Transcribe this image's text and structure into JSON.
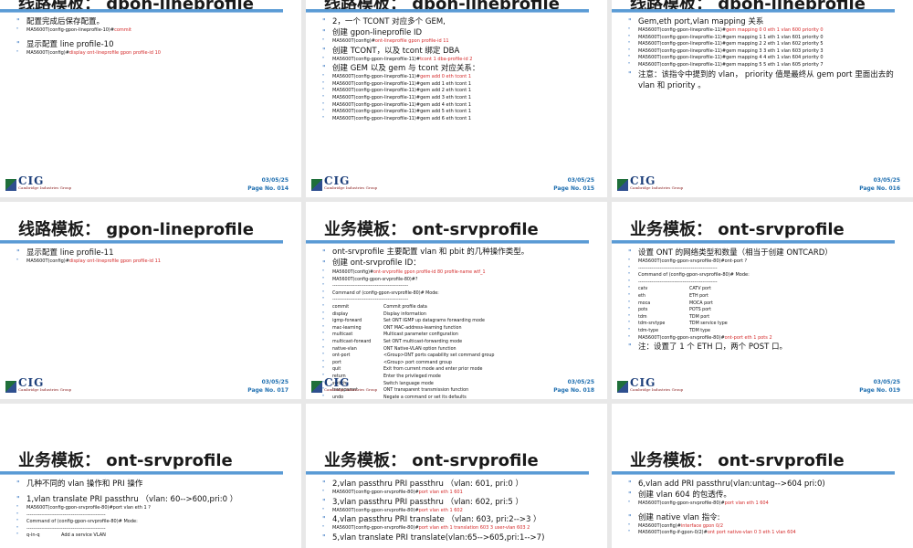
{
  "footer": {
    "date": "03/05/25",
    "logo": "CIG",
    "logo_sub": "Cambridge Industries Group",
    "page_prefix": "Page No. "
  },
  "slides": {
    "s14": {
      "title": "线路模板： gpon-lineprofile",
      "page": "014",
      "l1": "配置完成后保存配置。",
      "l2a": "MA5600T(config-gpon-lineprofile-10)#",
      "l2b": "commit",
      "l3": "显示配置 line profile-10",
      "l4a": "MA5600T(config)#",
      "l4b": "display ont-lineprofile gpon profile-id 10"
    },
    "s15": {
      "title": "线路模板： gpon-lineprofile",
      "page": "015",
      "l1": "2，一个 TCONT 对应多个 GEM,",
      "l2": "创建 gpon-lineprofile ID",
      "l3a": "MA5600T(config)#",
      "l3b": "ont-lineprofile gpon profile-id 11",
      "l4": "创建 TCONT，以及 tcont 绑定 DBA",
      "l5a": "MA5600T(config-gpon-lineprofile-11)#",
      "l5b": "tcont 1 dba-profile-id 2",
      "l6": "创建 GEM 以及 gem 与 tcont 对应关系：",
      "gems": [
        {
          "a": "MA5600T(config-gpon-lineprofile-11)#",
          "b": "gem add 0 eth tcont 1",
          "red": true
        },
        {
          "a": "MA5600T(config-gpon-lineprofile-11)#gem add 1 eth tcont 1",
          "b": "",
          "red": false
        },
        {
          "a": "MA5600T(config-gpon-lineprofile-11)#gem add 2 eth tcont 1",
          "b": "",
          "red": false
        },
        {
          "a": "MA5600T(config-gpon-lineprofile-11)#gem add 3 eth tcont 1",
          "b": "",
          "red": false
        },
        {
          "a": "MA5600T(config-gpon-lineprofile-11)#gem add 4 eth tcont 1",
          "b": "",
          "red": false
        },
        {
          "a": "MA5600T(config-gpon-lineprofile-11)#gem add 5 eth tcont 1",
          "b": "",
          "red": false
        },
        {
          "a": "MA5600T(config-gpon-lineprofile-11)#gem add 6 eth tcont 1",
          "b": "",
          "red": false
        }
      ]
    },
    "s16": {
      "title": "线路模板： gpon-lineprofile",
      "page": "016",
      "l1": "Gem,eth port,vlan mapping 关系",
      "maps": [
        {
          "a": "MA5600T(config-gpon-lineprofile-11)#",
          "b": "gem mapping 0 0 eth 1 vlan 600 priority 0",
          "red": true
        },
        {
          "a": "MA5600T(config-gpon-lineprofile-11)#gem mapping 1 1 eth 1 vlan 601 priority 0",
          "b": "",
          "red": false
        },
        {
          "a": "MA5600T(config-gpon-lineprofile-11)#gem mapping 2 2 eth 1 vlan 602 priority 5",
          "b": "",
          "red": false
        },
        {
          "a": "MA5600T(config-gpon-lineprofile-11)#gem mapping 3 3 eth 1 vlan 603 priority 3",
          "b": "",
          "red": false
        },
        {
          "a": "MA5600T(config-gpon-lineprofile-11)#gem mapping 4 4 eth 1 vlan 604 priority 0",
          "b": "",
          "red": false
        },
        {
          "a": "MA5600T(config-gpon-lineprofile-11)#gem mapping 5 5 eth 1 vlan 605 priority 7",
          "b": "",
          "red": false
        }
      ],
      "note": "注意：该指令中提到的 vlan， priority 值是最终从 gem port 里面出去的 vlan 和 priority 。"
    },
    "s17": {
      "title": "线路模板： gpon-lineprofile",
      "page": "017",
      "l1": "显示配置 line profile-11",
      "l2a": "MA5600T(config)#",
      "l2b": "display ont-lineprofile gpon profile-id 11"
    },
    "s18": {
      "title": "业务模板： ont-srvprofile",
      "page": "018",
      "l1": "ont-srvprofile 主要配置 vlan 和 pbit 的几种操作类型。",
      "l2": "创建 ont-srvprofile ID：",
      "l3a": "MA5600T(config)#",
      "l3b": "ont-srvprofile gpon profile-id 80 profile-name wtf_1",
      "l4": "MA5600T(config-gpon-srvprofile-80)#?",
      "l5": "------------------------------------------------",
      "l6": "  Command of (config-gpon-srvprofile-80)# Mode:",
      "l7": "------------------------------------------------",
      "cmds": [
        {
          "k": "commit",
          "v": "Commit profile data"
        },
        {
          "k": "display",
          "v": "Display information"
        },
        {
          "k": "igmp-forward",
          "v": "Set ONT IGMP up datagrams forwarding mode"
        },
        {
          "k": "mac-learning",
          "v": "ONT MAC-address-learning function"
        },
        {
          "k": "multicast",
          "v": "Multicast parameter configuration"
        },
        {
          "k": "multicast-forward",
          "v": "Set ONT multicast-forwarding mode"
        },
        {
          "k": "native-vlan",
          "v": "ONT Native-VLAN option function"
        },
        {
          "k": "ont-port",
          "v": "<Group>ONT ports capability set command group"
        },
        {
          "k": "port",
          "v": "<Group> port command group"
        },
        {
          "k": "quit",
          "v": "Exit from current mode and enter prior mode"
        },
        {
          "k": "return",
          "v": "Enter the privileged mode"
        },
        {
          "k": "switch",
          "v": "Switch language mode"
        },
        {
          "k": "transparent",
          "v": "ONT transparent transmission function"
        },
        {
          "k": "undo",
          "v": "Negate a command or set its defaults"
        }
      ]
    },
    "s19": {
      "title": "业务模板： ont-srvprofile",
      "page": "019",
      "l1": "设置 ONT 的网络类型和数量（相当于创建 ONTCARD）",
      "l2": "MA5600T(config-gpon-srvprofile-80)#ont-port ?",
      "l3": "------------------------------------------------",
      "l4": "  Command of (config-gpon-srvprofile-80)# Mode:",
      "l5": "------------------------------------------------",
      "ports": [
        {
          "k": "catv",
          "v": "CATV port"
        },
        {
          "k": "eth",
          "v": "ETH port"
        },
        {
          "k": "moca",
          "v": "MOCA port"
        },
        {
          "k": "pots",
          "v": "POTS port"
        },
        {
          "k": "tdm",
          "v": "TDM port"
        },
        {
          "k": "tdm-srvtype",
          "v": "TDM service type"
        },
        {
          "k": "tdm-type",
          "v": "TDM type"
        }
      ],
      "l6a": "MA5600T(config-gpon-srvprofile-80)#",
      "l6b": "ont-port eth 1 pots 2",
      "note": "注：设置了 1 个 ETH 口，两个 POST 口。"
    },
    "s20": {
      "title": "业务模板： ont-srvprofile",
      "l1": "几种不同的 vlan 操作和 PRI 操作",
      "l2": "1,vlan translate PRI passthru （vlan: 60-->600,pri:0 ）",
      "l3": "MA5600T(config-gpon-srvprofile-80)#port vlan eth 1 ?",
      "l4": "------------------------------------------------",
      "l5": "  Command of (config-gpon-srvprofile-80)# Mode:",
      "l6": "------------------------------------------------",
      "l7k": "q-in-q",
      "l7v": "Add a service VLAN"
    },
    "s21": {
      "title": "业务模板： ont-srvprofile",
      "l1": "2,vlan passthru PRI passthru （vlan: 601, pri:0 ）",
      "l2a": "MA5600T(config-gpon-srvprofile-80)#",
      "l2b": "port vlan eth 1 601",
      "l3": "3,vlan passthru PRI passthru （vlan: 602, pri:5 ）",
      "l4a": "MA5600T(config-gpon-srvprofile-80)#",
      "l4b": "port vlan eth 1 602",
      "l5": "4,vlan passthru PRI translate （vlan: 603, pri:2-->3 ）",
      "l6a": "MA5600T(config-gpon-srvprofile-80)#",
      "l6b": "port vlan eth 1 translation 603 3 user-vlan 603 2",
      "l7": "5,vlan translate PRI translate(vlan:65-->605,pri:1-->7)"
    },
    "s22": {
      "title": "业务模板： ont-srvprofile",
      "l1": "6,vlan add PRI passthru(vlan:untag-->604 pri:0)",
      "l2": "创建 vlan 604 的包透传。",
      "l3a": "MA5600T(config-gpon-srvprofile-80)#",
      "l3b": "port vlan eth 1 604",
      "l4": "创建 native vlan 指令:",
      "l5a": "MA5600T(config)#",
      "l5b": "interface gpon 0/2",
      "l6a": "MA5600T(config-if-gpon-0/2)#",
      "l6b": "ont port native-vlan 0 3 eth 1 vlan 604"
    }
  }
}
